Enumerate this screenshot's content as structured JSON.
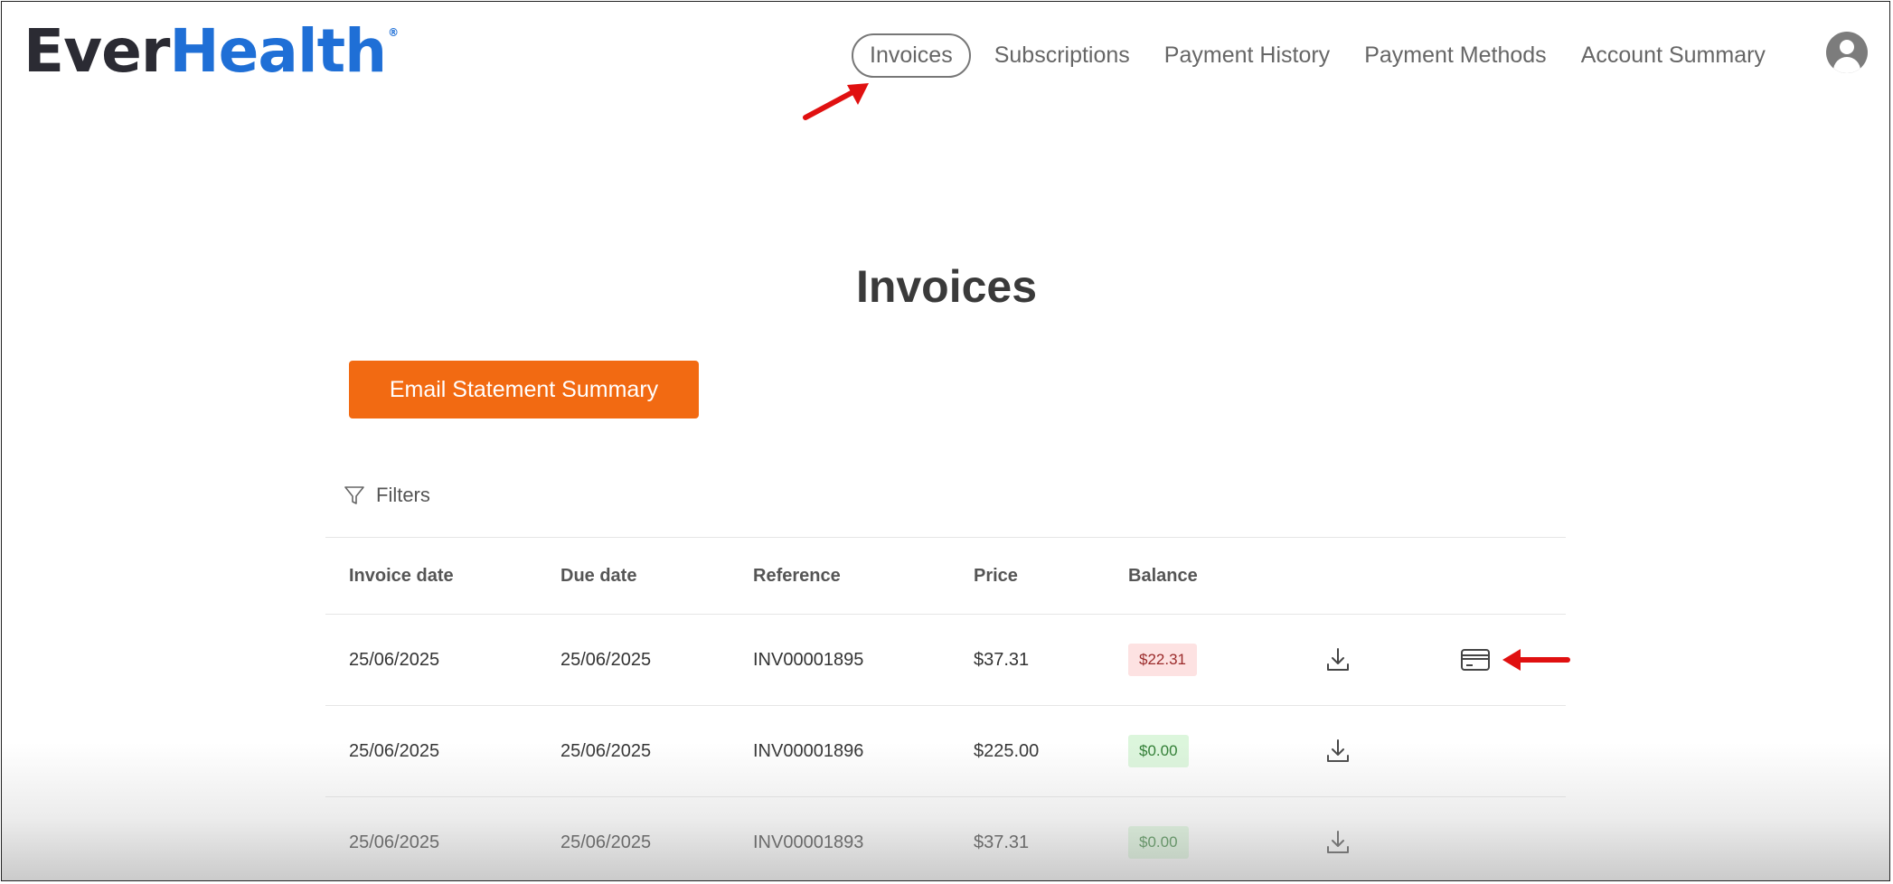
{
  "brand": {
    "part1": "Ever",
    "part2": "Health",
    "reg": "®"
  },
  "nav": {
    "items": [
      "Invoices",
      "Subscriptions",
      "Payment History",
      "Payment Methods",
      "Account Summary"
    ],
    "active": "Invoices"
  },
  "page": {
    "title": "Invoices",
    "email_button": "Email Statement Summary",
    "filters_label": "Filters"
  },
  "table": {
    "headers": [
      "Invoice date",
      "Due date",
      "Reference",
      "Price",
      "Balance"
    ],
    "rows": [
      {
        "invoice_date": "25/06/2025",
        "due_date": "25/06/2025",
        "reference": "INV00001895",
        "price": "$37.31",
        "balance": "$22.31",
        "balance_status": "owed",
        "has_pay": true
      },
      {
        "invoice_date": "25/06/2025",
        "due_date": "25/06/2025",
        "reference": "INV00001896",
        "price": "$225.00",
        "balance": "$0.00",
        "balance_status": "paid",
        "has_pay": false
      },
      {
        "invoice_date": "25/06/2025",
        "due_date": "25/06/2025",
        "reference": "INV00001893",
        "price": "$37.31",
        "balance": "$0.00",
        "balance_status": "paid",
        "has_pay": false
      }
    ]
  },
  "colors": {
    "brand_blue": "#1f6fd6",
    "accent_orange": "#f26a12",
    "annotation_red": "#e01010"
  },
  "icons": [
    "filter-icon",
    "download-icon",
    "credit-card-icon",
    "user-avatar-icon",
    "red-arrow-annotation"
  ]
}
